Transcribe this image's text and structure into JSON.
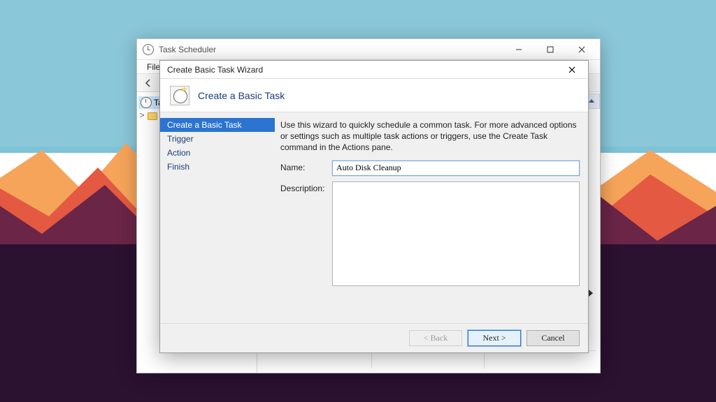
{
  "parent_window": {
    "title": "Task Scheduler",
    "menu": {
      "file": "File"
    },
    "tree": {
      "root": "Task Scheduler",
      "expander": ">"
    }
  },
  "wizard": {
    "window_title": "Create Basic Task Wizard",
    "header": "Create a Basic Task",
    "nav": {
      "step1": "Create a Basic Task",
      "step2": "Trigger",
      "step3": "Action",
      "step4": "Finish"
    },
    "instructions": "Use this wizard to quickly schedule a common task.  For more advanced options or settings such as multiple task actions or triggers, use the Create Task command in the Actions pane.",
    "labels": {
      "name": "Name:",
      "description": "Description:"
    },
    "fields": {
      "name_value": "Auto Disk Cleanup",
      "description_value": ""
    },
    "buttons": {
      "back": "< Back",
      "next": "Next >",
      "cancel": "Cancel"
    }
  }
}
